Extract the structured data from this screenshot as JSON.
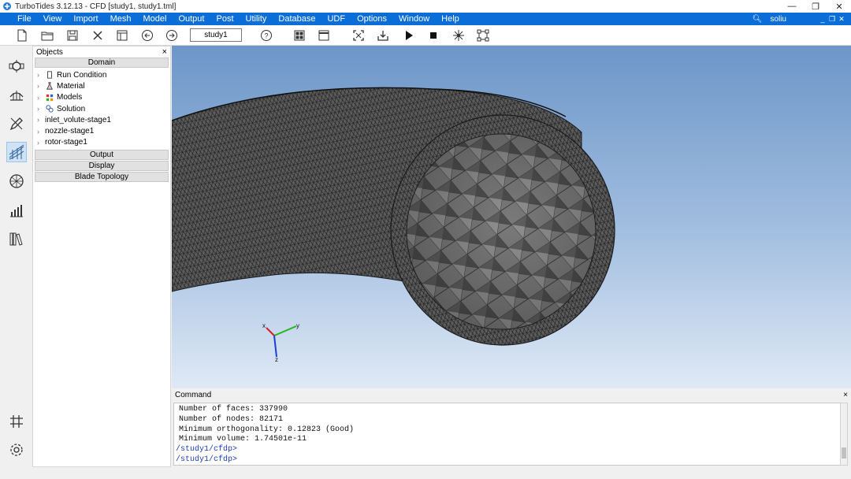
{
  "app": {
    "title": "TurboTides 3.12.13 - CFD [study1, study1.tml]"
  },
  "menu": {
    "items": [
      "File",
      "View",
      "Import",
      "Mesh",
      "Model",
      "Output",
      "Post",
      "Utility",
      "Database",
      "UDF",
      "Options",
      "Window",
      "Help"
    ],
    "user": "soliu"
  },
  "toolbar": {
    "study_name": "study1",
    "icons": [
      "new-file-icon",
      "open-folder-icon",
      "save-icon",
      "close-x-icon",
      "layout-panel-icon",
      "back-circle-icon",
      "forward-circle-icon",
      "help-icon",
      "grid-view-icon",
      "window-icon",
      "fit-view-icon",
      "export-icon",
      "run-play-icon",
      "stop-icon",
      "mesh-star-icon",
      "node-graph-icon"
    ]
  },
  "leftbar": {
    "icons": [
      "blade-row-icon",
      "flow-path-icon",
      "edit-pencil-icon",
      "mesh-cfd-icon",
      "sphere-mesh-icon",
      "chart-bars-icon",
      "library-books-icon",
      "grid-hash-icon",
      "settings-gear-icon"
    ]
  },
  "objects": {
    "title": "Objects",
    "close": "×",
    "sections": {
      "domain": "Domain",
      "output": "Output",
      "display": "Display",
      "blade_topology": "Blade Topology"
    },
    "tree": [
      {
        "label": "Run Condition",
        "icon": "run-condition-icon"
      },
      {
        "label": "Material",
        "icon": "material-flask-icon"
      },
      {
        "label": "Models",
        "icon": "models-icon"
      },
      {
        "label": "Solution",
        "icon": "solution-icon"
      },
      {
        "label": "inlet_volute-stage1",
        "icon": ""
      },
      {
        "label": "nozzle-stage1",
        "icon": ""
      },
      {
        "label": "rotor-stage1",
        "icon": ""
      }
    ]
  },
  "viewport": {
    "axes": {
      "x": "x",
      "y": "y",
      "z": "z"
    },
    "colors": {
      "sky_top": "#6d96c8",
      "sky_bottom": "#dfe9f6",
      "mesh_face": "#5a5a5a",
      "mesh_line": "#1a1a1a"
    }
  },
  "command": {
    "title": "Command",
    "close": "×",
    "lines": [
      "Number of faces: 337990",
      "Number of nodes: 82171",
      "Minimum orthogonality: 0.12823 (Good)",
      "Minimum volume: 1.74501e-11"
    ],
    "prompts": [
      "/study1/cfdp>",
      "/study1/cfdp>"
    ]
  },
  "colors": {
    "menubar": "#0a6dd8",
    "accent_active": "#cfe3f5"
  }
}
